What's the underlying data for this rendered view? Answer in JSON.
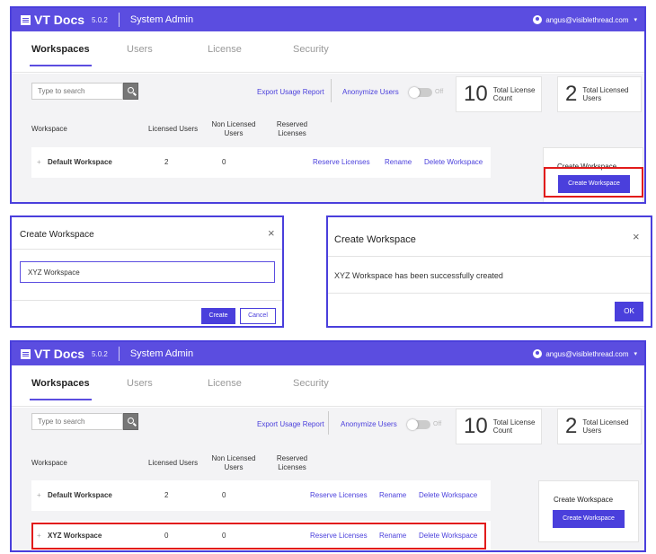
{
  "app": {
    "logo": "VT Docs",
    "version": "5.0.2",
    "section": "System Admin",
    "user_email": "angus@visiblethread.com",
    "caret": "▾"
  },
  "tabs": [
    "Workspaces",
    "Users",
    "License",
    "Security"
  ],
  "toolbar": {
    "search_placeholder": "Type to search",
    "export_label": "Export Usage Report",
    "anonymize_label": "Anonymize Users",
    "toggle_state": "Off",
    "total_license_count": "10",
    "total_license_count_label": "Total License Count",
    "total_licensed_users": "2",
    "total_licensed_users_label": "Total Licensed Users"
  },
  "table": {
    "headers": [
      "Workspace",
      "Licensed Users",
      "Non Licensed Users",
      "Reserved Licenses"
    ],
    "row_actions": [
      "Reserve Licenses",
      "Rename",
      "Delete Workspace"
    ],
    "expand_symbol": "+"
  },
  "before_rows": [
    {
      "name": "Default Workspace",
      "licensed": "2",
      "non_licensed": "0"
    }
  ],
  "after_rows": [
    {
      "name": "Default Workspace",
      "licensed": "2",
      "non_licensed": "0"
    },
    {
      "name": "XYZ Workspace",
      "licensed": "0",
      "non_licensed": "0"
    }
  ],
  "create_card": {
    "title": "Create Workspace",
    "button": "Create Workspace"
  },
  "create_dialog": {
    "title": "Create Workspace",
    "input_value": "XYZ Workspace",
    "create_button": "Create",
    "cancel_button": "Cancel",
    "close": "×"
  },
  "success_dialog": {
    "title": "Create Workspace",
    "message": "XYZ Workspace has been successfully created",
    "ok_button": "OK",
    "close": "×"
  },
  "colors": {
    "brand": "#5b4de0",
    "accent": "#4a3fdc",
    "highlight": "#e21b1b"
  }
}
